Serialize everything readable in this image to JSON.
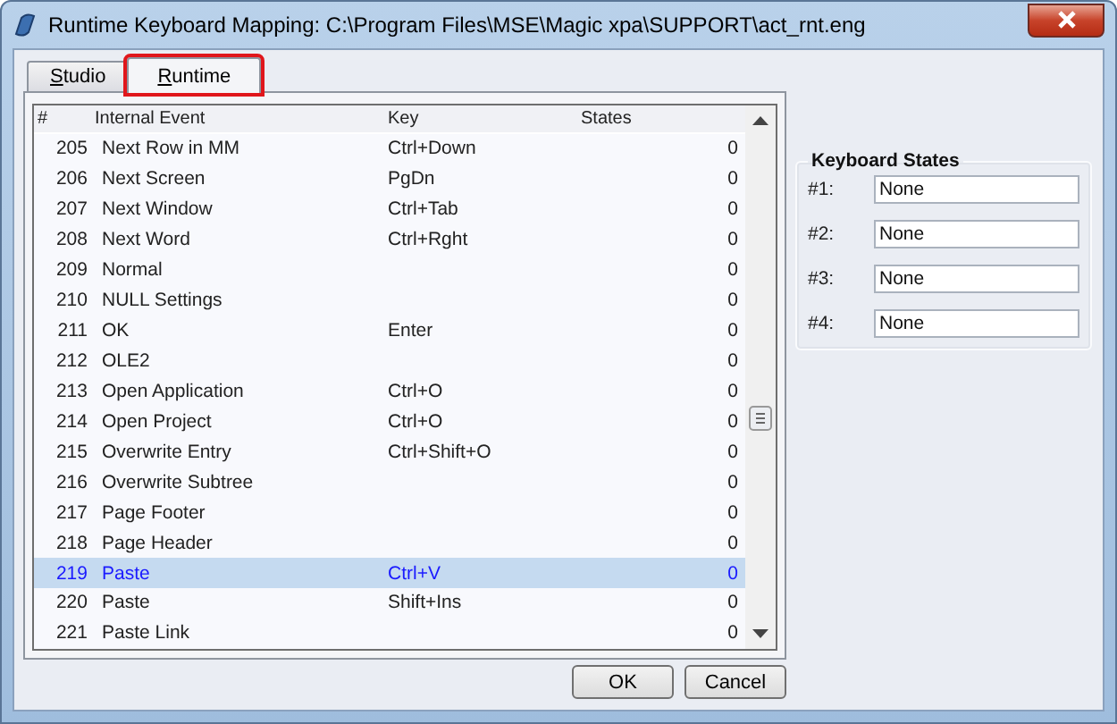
{
  "window": {
    "title": "Runtime Keyboard Mapping: C:\\Program Files\\MSE\\Magic xpa\\SUPPORT\\act_rnt.eng"
  },
  "tabs": [
    {
      "label": "Studio",
      "selected": false,
      "highlighted": false
    },
    {
      "label": "Runtime",
      "selected": true,
      "highlighted": true
    }
  ],
  "table": {
    "columns": [
      "#",
      "Internal Event",
      "Key",
      "States"
    ],
    "rows": [
      {
        "number": "205",
        "event": "Next Row in MM",
        "key": "Ctrl+Down",
        "states": "0",
        "selected": false
      },
      {
        "number": "206",
        "event": "Next Screen",
        "key": "PgDn",
        "states": "0",
        "selected": false
      },
      {
        "number": "207",
        "event": "Next Window",
        "key": "Ctrl+Tab",
        "states": "0",
        "selected": false
      },
      {
        "number": "208",
        "event": "Next Word",
        "key": "Ctrl+Rght",
        "states": "0",
        "selected": false
      },
      {
        "number": "209",
        "event": "Normal",
        "states": "0",
        "selected": false
      },
      {
        "number": "210",
        "event": "NULL Settings",
        "states": "0",
        "selected": false
      },
      {
        "number": "211",
        "event": "OK",
        "key": "Enter",
        "states": "0",
        "selected": false
      },
      {
        "number": "212",
        "event": "OLE2",
        "states": "0",
        "selected": false
      },
      {
        "number": "213",
        "event": "Open Application",
        "key": "Ctrl+O",
        "states": "0",
        "selected": false
      },
      {
        "number": "214",
        "event": "Open Project",
        "key": "Ctrl+O",
        "states": "0",
        "selected": false
      },
      {
        "number": "215",
        "event": "Overwrite Entry",
        "key": "Ctrl+Shift+O",
        "states": "0",
        "selected": false
      },
      {
        "number": "216",
        "event": "Overwrite Subtree",
        "states": "0",
        "selected": false
      },
      {
        "number": "217",
        "event": "Page Footer",
        "states": "0",
        "selected": false
      },
      {
        "number": "218",
        "event": "Page Header",
        "states": "0",
        "selected": false
      },
      {
        "number": "219",
        "event": "Paste",
        "key": "Ctrl+V",
        "states": "0",
        "selected": true
      },
      {
        "number": "220",
        "event": "Paste",
        "key": "Shift+Ins",
        "states": "0",
        "selected": false
      },
      {
        "number": "221",
        "event": "Paste Link",
        "states": "0",
        "selected": false
      }
    ]
  },
  "keyboard_states": {
    "title": "Keyboard States",
    "fields": [
      {
        "label": "#1:",
        "value": "None"
      },
      {
        "label": "#2:",
        "value": "None"
      },
      {
        "label": "#3:",
        "value": "None"
      },
      {
        "label": "#4:",
        "value": "None"
      }
    ]
  },
  "buttons": [
    "OK",
    "Cancel"
  ]
}
